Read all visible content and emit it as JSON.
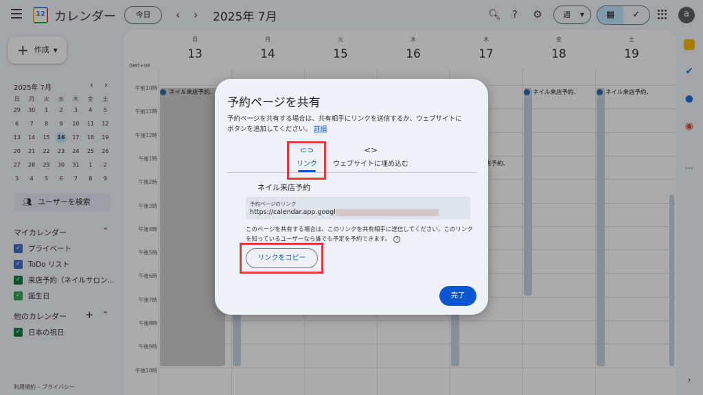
{
  "header": {
    "app_title": "カレンダー",
    "logo_number": "12",
    "today_label": "今日",
    "month_title": "2025年 7月",
    "view_label": "週",
    "avatar_letter": "a"
  },
  "sidebar": {
    "create_label": "作成",
    "mini_cal": {
      "title": "2025年 7月",
      "dow": [
        "日",
        "月",
        "火",
        "水",
        "木",
        "金",
        "土"
      ],
      "weeks": [
        [
          "29",
          "30",
          "1",
          "2",
          "3",
          "4",
          "5"
        ],
        [
          "6",
          "7",
          "8",
          "9",
          "10",
          "11",
          "12"
        ],
        [
          "13",
          "14",
          "15",
          "16",
          "17",
          "18",
          "19"
        ],
        [
          "20",
          "21",
          "22",
          "23",
          "24",
          "25",
          "26"
        ],
        [
          "27",
          "28",
          "29",
          "30",
          "31",
          "1",
          "2"
        ],
        [
          "3",
          "4",
          "5",
          "6",
          "7",
          "8",
          "9"
        ]
      ],
      "today": "16"
    },
    "search_people": "ユーザーを検索",
    "my_calendars_title": "マイカレンダー",
    "my_calendars": [
      {
        "label": "プライベート",
        "color": "#3f6fd1"
      },
      {
        "label": "ToDo リスト",
        "color": "#3f6fd1"
      },
      {
        "label": "来店予約（ネイルサロン...",
        "color": "#137e43"
      },
      {
        "label": "誕生日",
        "color": "#34a853"
      }
    ],
    "other_calendars_title": "他のカレンダー",
    "other_calendars": [
      {
        "label": "日本の祝日",
        "color": "#137e43"
      }
    ],
    "footer": "利用規約 – プライバシー"
  },
  "grid": {
    "timezone": "GMT+09",
    "days": [
      {
        "dow": "日",
        "num": "13"
      },
      {
        "dow": "月",
        "num": "14"
      },
      {
        "dow": "火",
        "num": "15"
      },
      {
        "dow": "水",
        "num": "16"
      },
      {
        "dow": "木",
        "num": "17"
      },
      {
        "dow": "金",
        "num": "18"
      },
      {
        "dow": "土",
        "num": "19"
      }
    ],
    "hours": [
      "午前10時",
      "午前11時",
      "午後12時",
      "午後1時",
      "午後2時",
      "午後3時",
      "午後4時",
      "午後5時",
      "午後6時",
      "午後7時",
      "午後8時",
      "午後9時",
      "午後10時"
    ],
    "event_label": "ネイル来店予約、",
    "event_label_short": "店予約、"
  },
  "dialog": {
    "title": "予約ページを共有",
    "description": "予約ページを共有する場合は、共有相手にリンクを送信するか、ウェブサイトにボタンを追加してください。",
    "details_link": "詳細",
    "tab_link": "リンク",
    "tab_embed": "ウェブサイトに埋め込む",
    "page_name": "ネイル来店予約",
    "link_label": "予約ページのリンク",
    "link_url": "https://calendar.app.google/",
    "help_text": "このページを共有する場合は、このリンクを共有相手に送信してください。このリンクを知っているユーザーなら誰でも予定を予約できます。",
    "copy_button": "リンクをコピー",
    "done_button": "完了"
  },
  "colors": {
    "accent": "#0b57d0",
    "highlight": "#e53935"
  }
}
